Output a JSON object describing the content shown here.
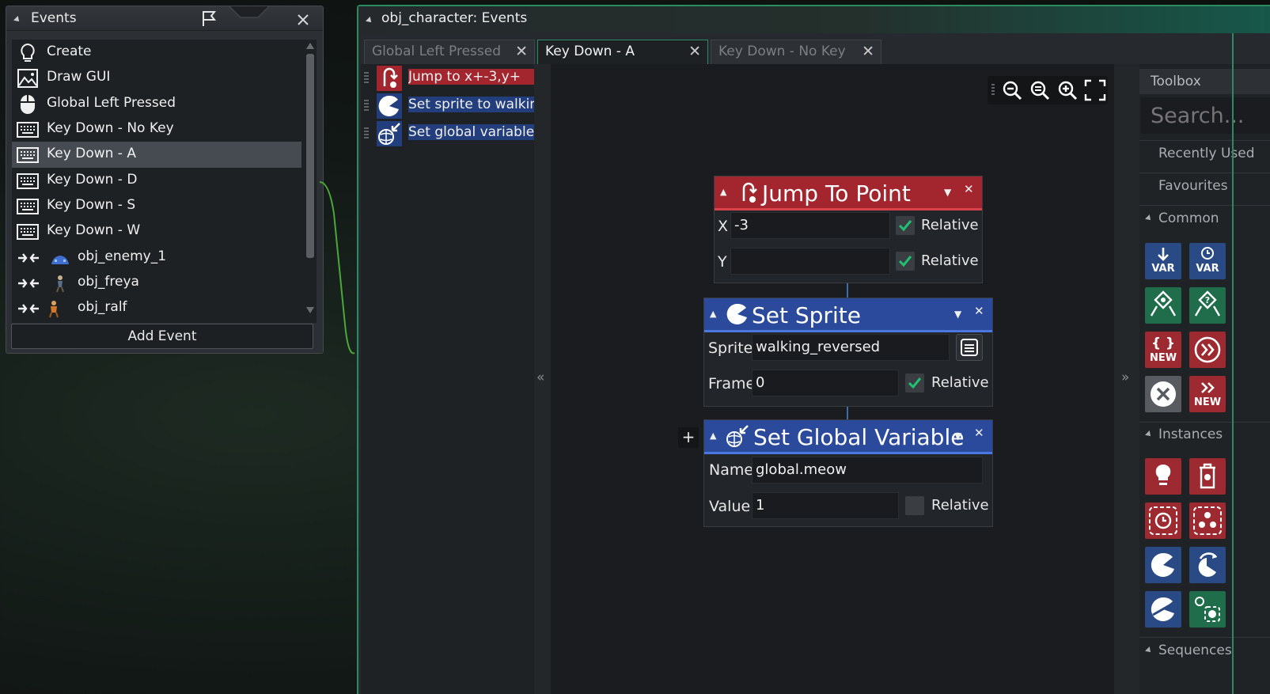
{
  "events_panel": {
    "title": "Events",
    "add_event_label": "Add Event",
    "items": [
      {
        "label": "Create",
        "icon": "lightbulb-icon"
      },
      {
        "label": "Draw GUI",
        "icon": "draw-image-icon"
      },
      {
        "label": "Global Left Pressed",
        "icon": "mouse-icon"
      },
      {
        "label": "Key Down - No Key",
        "icon": "keyboard-icon"
      },
      {
        "label": "Key Down - A",
        "icon": "keyboard-icon",
        "selected": true
      },
      {
        "label": "Key Down - D",
        "icon": "keyboard-icon"
      },
      {
        "label": "Key Down - S",
        "icon": "keyboard-icon"
      },
      {
        "label": "Key Down - W",
        "icon": "keyboard-icon"
      },
      {
        "label": "obj_enemy_1",
        "icon": "collision-icon"
      },
      {
        "label": "obj_freya",
        "icon": "collision-icon"
      },
      {
        "label": "obj_ralf",
        "icon": "collision-icon"
      }
    ]
  },
  "object_editor": {
    "title": "obj_character: Events",
    "tabs": [
      {
        "label": "Global Left Pressed",
        "active": false
      },
      {
        "label": "Key Down - A",
        "active": true
      },
      {
        "label": "Key Down - No Key",
        "active": false
      }
    ],
    "action_list": [
      {
        "label": "Jump to x+-3,y+",
        "icon": "jump-to-point-icon",
        "color": "#a3262f"
      },
      {
        "label": "Set sprite to walking_reversed",
        "icon": "set-sprite-icon",
        "color": "#233e7c"
      },
      {
        "label": "Set global variable global.meow",
        "icon": "set-global-variable-icon",
        "color": "#233e7c"
      }
    ],
    "blocks": {
      "jump": {
        "title": "Jump To Point",
        "x_label": "X",
        "x_value": "-3",
        "x_relative": true,
        "y_label": "Y",
        "y_value": "",
        "y_relative": true,
        "relative_label": "Relative",
        "color": "#b3262f"
      },
      "sprite": {
        "title": "Set Sprite",
        "sprite_label": "Sprite",
        "sprite_value": "walking_reversed",
        "frame_label": "Frame",
        "frame_value": "0",
        "frame_relative": true,
        "relative_label": "Relative",
        "color": "#2a4a9a"
      },
      "global_var": {
        "title": "Set Global Variable",
        "name_label": "Name",
        "name_value": "global.meow",
        "value_label": "Value",
        "value_value": "1",
        "value_relative": false,
        "relative_label": "Relative",
        "color": "#2a4a9a"
      }
    },
    "add_symbol": "+",
    "left_collapse": "«",
    "right_collapse": "»"
  },
  "toolbox": {
    "title": "Toolbox",
    "search_placeholder": "Search...",
    "recently_used": "Recently Used",
    "favourites": "Favourites",
    "sections": {
      "common": "Common",
      "instances": "Instances",
      "sequences": "Sequences"
    },
    "tile_text": {
      "var": "VAR",
      "new": "NEW"
    }
  },
  "colors": {
    "accent_green": "#2c8c61",
    "action_red": "#a3262f",
    "action_blue": "#233e7c",
    "check_green": "#1fc072"
  }
}
